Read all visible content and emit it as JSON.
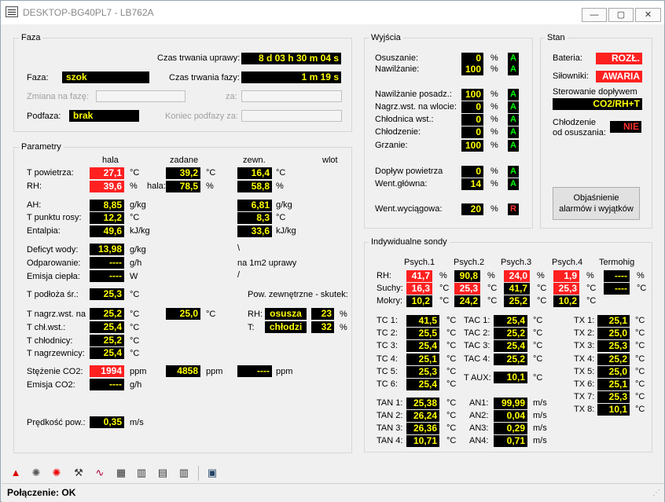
{
  "window": {
    "title": "DESKTOP-BG40PL7 - LB762A",
    "min": "—",
    "max": "▢",
    "close": "✕"
  },
  "faza": {
    "label": "Faza",
    "czas_uprawy_lbl": "Czas trwania uprawy:",
    "czas_uprawy": "8 d 03 h 30 m 04 s",
    "faza_lbl": "Faza:",
    "faza": "szok",
    "czas_fazy_lbl": "Czas trwania fazy:",
    "czas_fazy": "1 m 19 s",
    "zmiana_lbl": "Zmiana na fazę:",
    "za_lbl": "za:",
    "podfaza_lbl": "Podfaza:",
    "podfaza": "brak",
    "koniec_lbl": "Koniec podfazy za:"
  },
  "param": {
    "label": "Parametry",
    "hala": "hala",
    "zadane": "zadane",
    "zewn": "zewn.",
    "wlot": "wlot",
    "tp_lbl": "T powietrza:",
    "tp_hala": "27,1",
    "tp_u1": "°C",
    "tp_zad": "39,2",
    "tp_u2": "°C",
    "tp_zewn": "16,4",
    "tp_u3": "°C",
    "rh_lbl": "RH:",
    "rh_hala": "39,6",
    "rh_u1": "%",
    "rh_hala_lbl": "hala:",
    "rh_zad": "78,5",
    "rh_u2": "%",
    "rh_zewn": "58,8",
    "rh_u3": "%",
    "ah_lbl": "AH:",
    "ah_hala": "8,85",
    "ah_u1": "g/kg",
    "ah_zewn": "6,81",
    "ah_u2": "g/kg",
    "tr_lbl": "T punktu rosy:",
    "tr_hala": "12,2",
    "tr_u1": "°C",
    "tr_zewn": "8,3",
    "tr_u2": "°C",
    "en_lbl": "Entalpia:",
    "en_hala": "49,6",
    "en_u1": "kJ/kg",
    "en_zewn": "33,6",
    "en_u2": "kJ/kg",
    "dw_lbl": "Deficyt wody:",
    "dw_val": "13,98",
    "dw_u": "g/kg",
    "dw_bs": "\\",
    "od_lbl": "Odparowanie:",
    "od_val": "----",
    "od_u": "g/h",
    "od_note": "na 1m2 uprawy",
    "ec_lbl": "Emisja ciepła:",
    "ec_val": "----",
    "ec_u": "W",
    "ec_sl": "/",
    "tps_lbl": "T podłoża śr.:",
    "tps_val": "25,3",
    "tps_u": "°C",
    "pz_lbl": "Pow. zewnętrzne - skutek:",
    "tn_lbl": "T nagrz.wst. na",
    "tn_val": "25,2",
    "tn_u": "°C",
    "tn_zad": "25,0",
    "tn_u2": "°C",
    "pz_rh_lbl": "RH:",
    "pz_rh_txt": "osusza",
    "pz_rh_val": "23",
    "pz_rh_u": "%",
    "tch_lbl": "T chł.wst.:",
    "tch_val": "25,4",
    "tch_u": "°C",
    "pz_t_lbl": "T:",
    "pz_t_txt": "chłodzi",
    "pz_t_val": "32",
    "pz_t_u": "%",
    "tc_lbl": "T chłodnicy:",
    "tc_val": "25,2",
    "tc_u": "°C",
    "tng_lbl": "T nagrzewnicy:",
    "tng_val": "25,4",
    "tng_u": "°C",
    "co2_lbl": "Stężenie CO2:",
    "co2_val": "1994",
    "co2_u": "ppm",
    "co2_zad": "4858",
    "co2_u2": "ppm",
    "co2_zewn": "----",
    "co2_u3": "ppm",
    "eco2_lbl": "Emisja CO2:",
    "eco2_val": "----",
    "eco2_u": "g/h",
    "pp_lbl": "Prędkość pow.:",
    "pp_val": "0,35",
    "pp_u": "m/s"
  },
  "wyj": {
    "label": "Wyjścia",
    "rows": [
      {
        "l": "Osuszanie:",
        "v": "0",
        "u": "%",
        "s": "A"
      },
      {
        "l": "Nawilżanie:",
        "v": "100",
        "u": "%",
        "s": "A"
      },
      {
        "l": "Nawilżanie posadz.:",
        "v": "100",
        "u": "%",
        "s": "A"
      },
      {
        "l": "Nagrz.wst. na wlocie:",
        "v": "0",
        "u": "%",
        "s": "A"
      },
      {
        "l": "Chłodnica wst.:",
        "v": "0",
        "u": "%",
        "s": "A"
      },
      {
        "l": "Chłodzenie:",
        "v": "0",
        "u": "%",
        "s": "A"
      },
      {
        "l": "Grzanie:",
        "v": "100",
        "u": "%",
        "s": "A"
      },
      {
        "l": "Dopływ powietrza",
        "v": "0",
        "u": "%",
        "s": "A"
      },
      {
        "l": "Went.główna:",
        "v": "14",
        "u": "%",
        "s": "A"
      },
      {
        "l": "Went.wyciągowa:",
        "v": "20",
        "u": "%",
        "s": "R"
      }
    ]
  },
  "stan": {
    "label": "Stan",
    "bat_lbl": "Bateria:",
    "bat": "ROZŁ.",
    "sil_lbl": "Siłowniki:",
    "sil": "AWARIA",
    "ster_lbl": "Sterowanie dopływem",
    "ster": "CO2/RH+T",
    "chl_lbl1": "Chłodzenie",
    "chl_lbl2": "od osuszania:",
    "chl": "NIE",
    "btn1": "Objaśnienie",
    "btn2": "alarmów i wyjątków"
  },
  "sondy": {
    "label": "Indywidualne sondy",
    "h1": "Psych.1",
    "h2": "Psych.2",
    "h3": "Psych.3",
    "h4": "Psych.4",
    "h5": "Termohigr",
    "rh_lbl": "RH:",
    "rh": [
      "41,7",
      "90,8",
      "24,0",
      "1,9",
      "----"
    ],
    "su_lbl": "Suchy:",
    "su": [
      "16,3",
      "25,3",
      "41,7",
      "25,3",
      "----"
    ],
    "mo_lbl": "Mokry:",
    "mo": [
      "10,2",
      "24,2",
      "25,2",
      "10,2"
    ],
    "pct": "%",
    "deg": "°C",
    "tc": [
      {
        "l": "TC 1:",
        "v": "41,5"
      },
      {
        "l": "TC 2:",
        "v": "25,5"
      },
      {
        "l": "TC 3:",
        "v": "25,4"
      },
      {
        "l": "TC 4:",
        "v": "25,1"
      },
      {
        "l": "TC 5:",
        "v": "25,3"
      },
      {
        "l": "TC 6:",
        "v": "25,4"
      }
    ],
    "tac": [
      {
        "l": "TAC 1:",
        "v": "25,4"
      },
      {
        "l": "TAC 2:",
        "v": "25,2"
      },
      {
        "l": "TAC 3:",
        "v": "25,4"
      },
      {
        "l": "TAC 4:",
        "v": "25,2"
      }
    ],
    "taux_lbl": "T AUX:",
    "taux": "10,1",
    "tx": [
      {
        "l": "TX 1:",
        "v": "25,1"
      },
      {
        "l": "TX 2:",
        "v": "25,0"
      },
      {
        "l": "TX 3:",
        "v": "25,3"
      },
      {
        "l": "TX 4:",
        "v": "25,2"
      },
      {
        "l": "TX 5:",
        "v": "25,0"
      },
      {
        "l": "TX 6:",
        "v": "25,1"
      },
      {
        "l": "TX 7:",
        "v": "25,3"
      },
      {
        "l": "TX 8:",
        "v": "10,1"
      }
    ],
    "tan": [
      {
        "l": "TAN 1:",
        "v": "25,38"
      },
      {
        "l": "TAN 2:",
        "v": "26,24"
      },
      {
        "l": "TAN 3:",
        "v": "26,36"
      },
      {
        "l": "TAN 4:",
        "v": "10,71"
      }
    ],
    "an": [
      {
        "l": "AN1:",
        "v": "99,99"
      },
      {
        "l": "AN2:",
        "v": "0,04"
      },
      {
        "l": "AN3:",
        "v": "0,29"
      },
      {
        "l": "AN4:",
        "v": "0,71"
      }
    ],
    "ms": "m/s"
  },
  "status": {
    "text": "Połączenie: OK"
  },
  "toolbar": {
    "icons": [
      "alarm-light-icon",
      "gear-icon",
      "red-gear-icon",
      "tools-icon",
      "chart-icon",
      "table-icon",
      "book-icon",
      "document-icon",
      "manual-icon",
      "monitor-icon"
    ]
  }
}
